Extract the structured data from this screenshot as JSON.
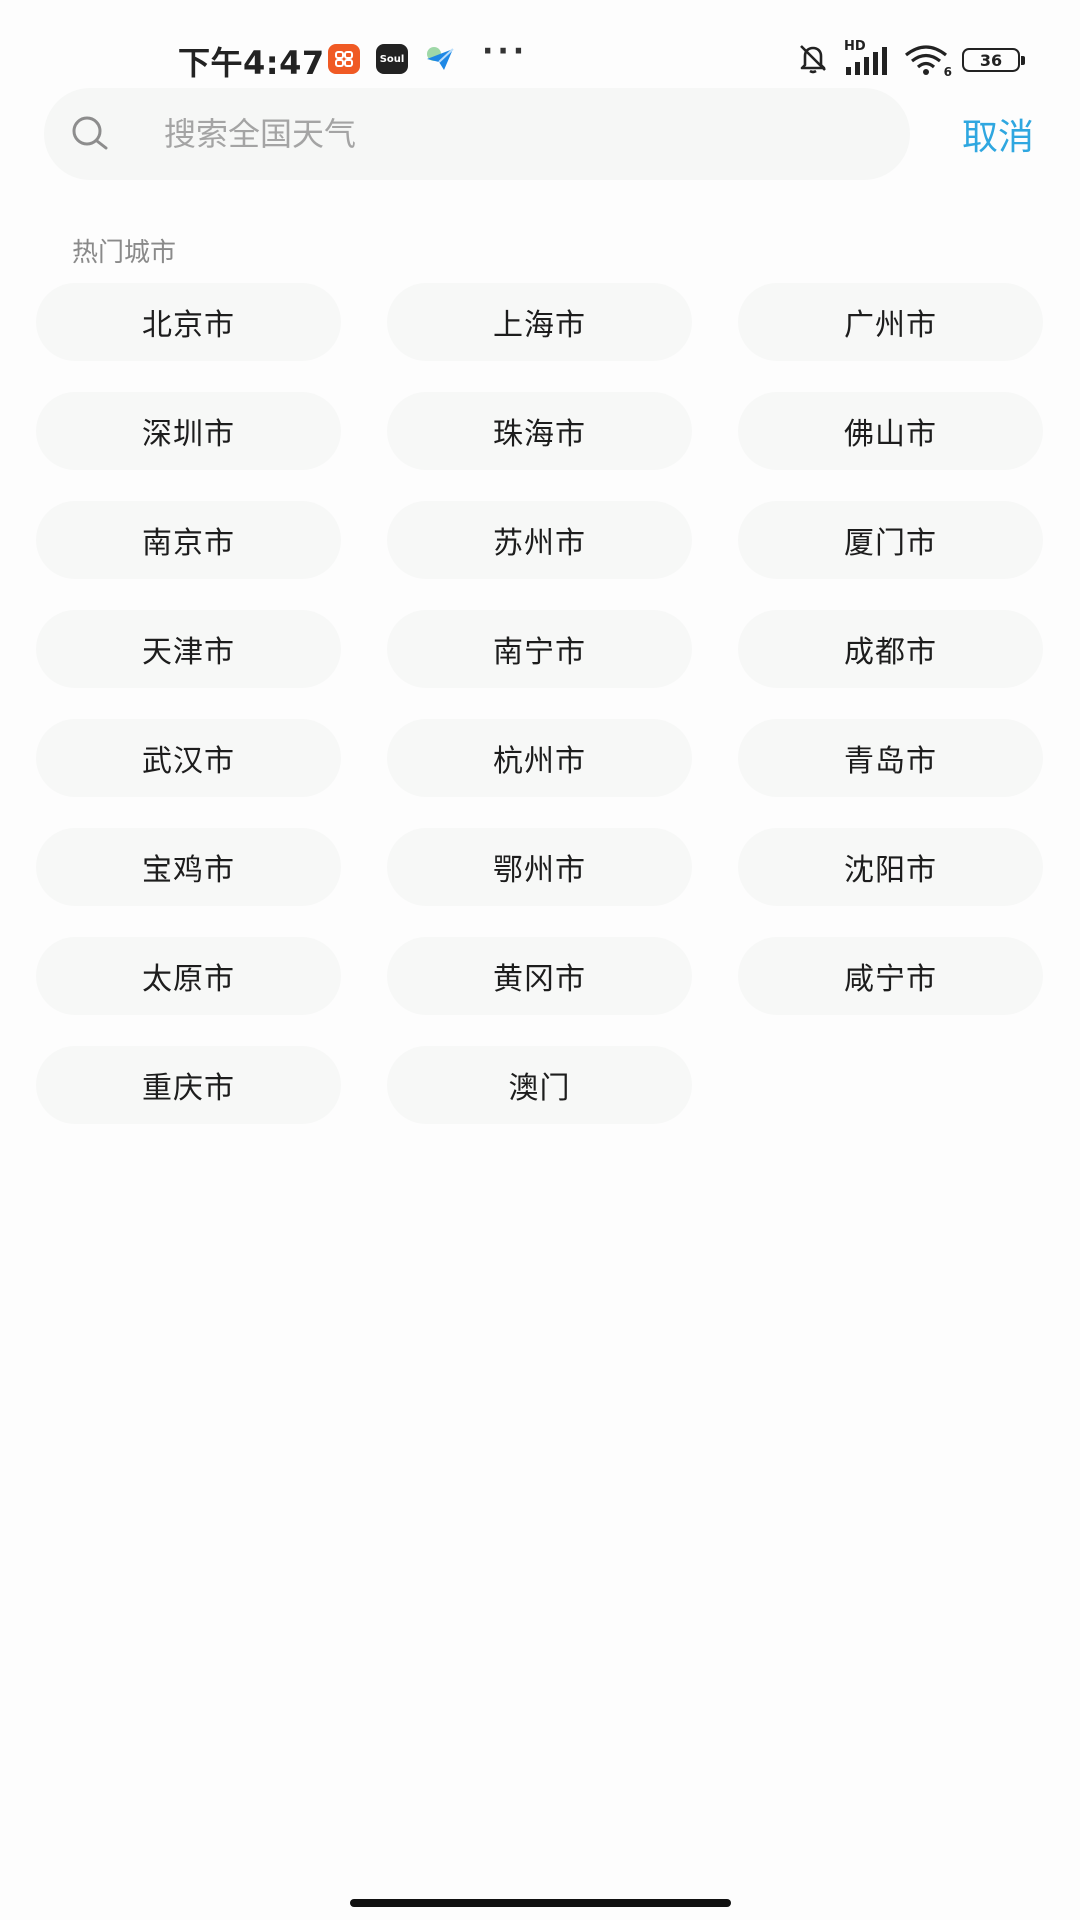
{
  "status_bar": {
    "time": "下午4:47",
    "app_icon_2_label": "Soul",
    "more": "···",
    "network_label": "HD",
    "wifi_label": "6",
    "battery_level": "36"
  },
  "search": {
    "placeholder": "搜索全国天气",
    "value": "",
    "cancel_label": "取消"
  },
  "hot_cities": {
    "title": "热门城市",
    "cities": [
      "北京市",
      "上海市",
      "广州市",
      "深圳市",
      "珠海市",
      "佛山市",
      "南京市",
      "苏州市",
      "厦门市",
      "天津市",
      "南宁市",
      "成都市",
      "武汉市",
      "杭州市",
      "青岛市",
      "宝鸡市",
      "鄂州市",
      "沈阳市",
      "太原市",
      "黄冈市",
      "咸宁市",
      "重庆市",
      "澳门"
    ]
  },
  "colors": {
    "accent": "#2fa7e0",
    "pill_background": "#f7f8f7",
    "section_title": "#8a8a8a"
  }
}
